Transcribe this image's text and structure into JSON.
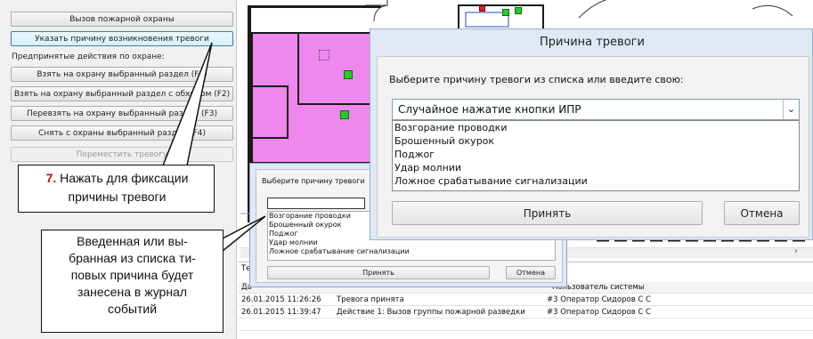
{
  "left_panel": {
    "buttons": [
      "Вызов пожарной охраны",
      "Указать причину возникновения тревоги"
    ],
    "section_label": "Предпринятые действия по охране:",
    "actions": [
      "Взять на охрану выбранный раздел (F1)",
      "Взять на охрану выбранный раздел с обходом (F2)",
      "Перевзять на охрану выбранный раздел (F3)",
      "Снять с охраны выбранный раздел (F4)"
    ],
    "move_button": "Переместить тревогу"
  },
  "journal": {
    "tab_label": "Те",
    "headers": [
      "Да",
      "Пользователь системы"
    ],
    "rows": [
      {
        "time": "26.01.2015 11:26:26",
        "event": "Тревога принята",
        "user": "#3 Оператор Сидоров С С"
      },
      {
        "time": "26.01.2015 11:39:47",
        "event": "Действие 1: Вызов группы пожарной разведки",
        "user": "#3 Оператор Сидоров С С"
      }
    ]
  },
  "small_dialog": {
    "prompt": "Выберите причину тревоги",
    "options": [
      "Возгорание проводки",
      "Брошенный окурок",
      "Поджог",
      "Удар молнии",
      "Ложное срабатывание сигнализации"
    ],
    "accept": "Принять",
    "cancel": "Отмена"
  },
  "big_dialog": {
    "title": "Причина тревоги",
    "prompt": "Выберите причину тревоги из списка или введите свою:",
    "input_value": "Случайное нажатие кнопки ИПР",
    "options": [
      "Возгорание проводки",
      "Брошенный окурок",
      "Поджог",
      "Удар молнии",
      "Ложное срабатывание сигнализации"
    ],
    "accept": "Принять",
    "cancel": "Отмена"
  },
  "callouts": {
    "step_number": "7.",
    "step_text_1": "Нажать для фиксации",
    "step_text_2": "причины тревоги",
    "note_lines": [
      "Введенная или вы-",
      "бранная из списка ти-",
      "повых причина будет",
      "занесена в журнал",
      "событий"
    ]
  },
  "colors": {
    "room_fill": "#ee88ee",
    "sensor_green": "#29c929",
    "callout_number": "#d40000",
    "dialog_frame": "#dfe8f3"
  }
}
